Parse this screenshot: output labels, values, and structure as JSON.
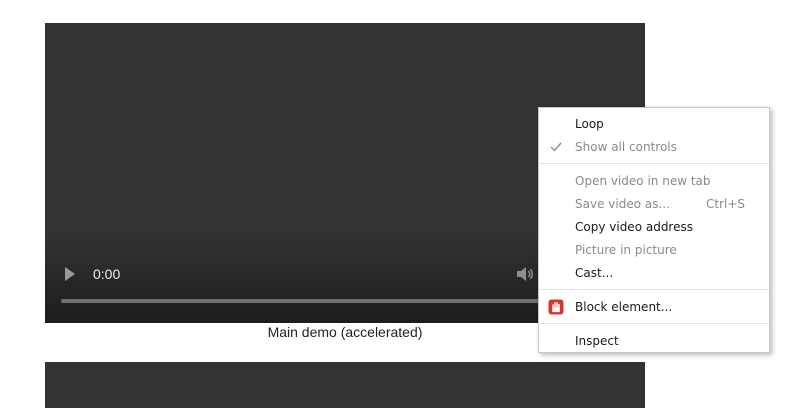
{
  "main_video": {
    "time": "0:00",
    "caption": "Main demo (accelerated)",
    "icons": {
      "play": "play-icon",
      "volume": "volume-icon"
    }
  },
  "context_menu": {
    "loop": "Loop",
    "show_all_controls": "Show all controls",
    "open_new_tab": "Open video in new tab",
    "save_video": "Save video as...",
    "save_shortcut": "Ctrl+S",
    "copy_address": "Copy video address",
    "picture_in_picture": "Picture in picture",
    "cast": "Cast...",
    "block_element": "Block element...",
    "inspect": "Inspect",
    "icons": {
      "checked": "checkmark-icon",
      "block": "stop-hand-icon"
    }
  },
  "colors": {
    "video_background": "#333333",
    "menu_text": "#1a1a1a",
    "menu_disabled_text": "#8a8a8a",
    "block_icon": "#d9362b"
  }
}
